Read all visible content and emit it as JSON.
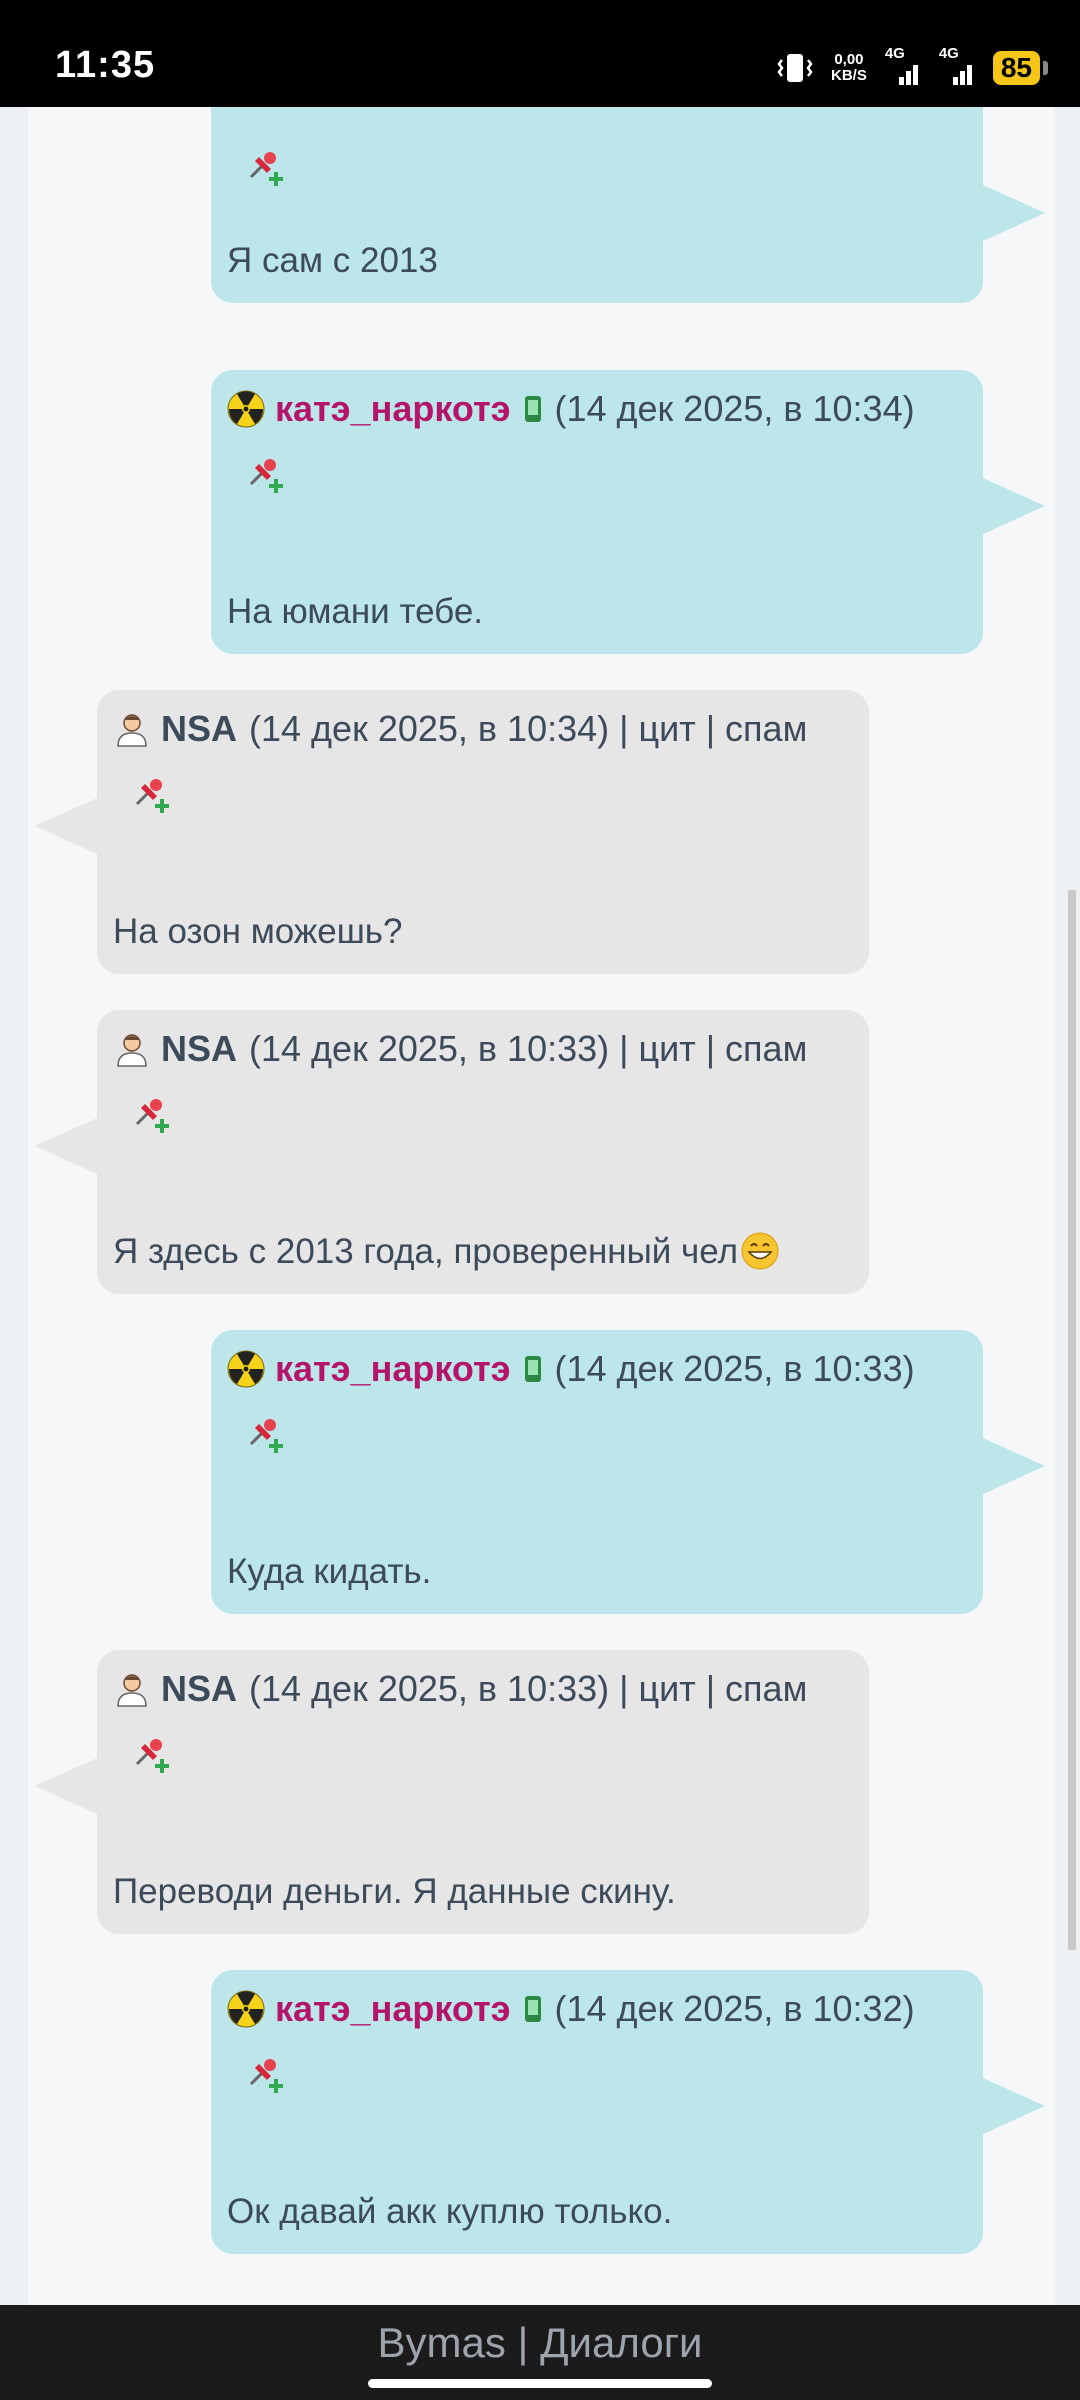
{
  "status_bar": {
    "time": "11:35",
    "speed_value": "0,00",
    "speed_unit": "KB/S",
    "net1": "4G",
    "net2": "4G",
    "battery": "85"
  },
  "messages": [
    {
      "side": "out",
      "nick": "",
      "meta": "",
      "text": "Я сам с 2013"
    },
    {
      "side": "out",
      "nick": "катэ_наркотэ",
      "meta": "(14 дек 2025, в 10:34)",
      "text": "На юмани тебе."
    },
    {
      "side": "in",
      "nick": "NSA",
      "meta": "(14 дек 2025, в 10:34) | цит | спам",
      "text": "На озон можешь?"
    },
    {
      "side": "in",
      "nick": "NSA",
      "meta": "(14 дек 2025, в 10:33) | цит | спам",
      "text": "Я здесь с 2013 года, проверенный чел"
    },
    {
      "side": "out",
      "nick": "катэ_наркотэ",
      "meta": "(14 дек 2025, в 10:33)",
      "text": "Куда кидать."
    },
    {
      "side": "in",
      "nick": "NSA",
      "meta": "(14 дек 2025, в 10:33) | цит | спам",
      "text": "Переводи деньги. Я данные скину."
    },
    {
      "side": "out",
      "nick": "катэ_наркотэ",
      "meta": "(14 дек 2025, в 10:32)",
      "text": "Ок давай акк куплю только."
    }
  ],
  "footer": {
    "title": "Bymas | Диалоги"
  },
  "colors": {
    "outgoing_bubble": "#bde6ea",
    "incoming_bubble": "#e6e6e6",
    "nick_out": "#b5146b",
    "text": "#3c4a5a"
  }
}
